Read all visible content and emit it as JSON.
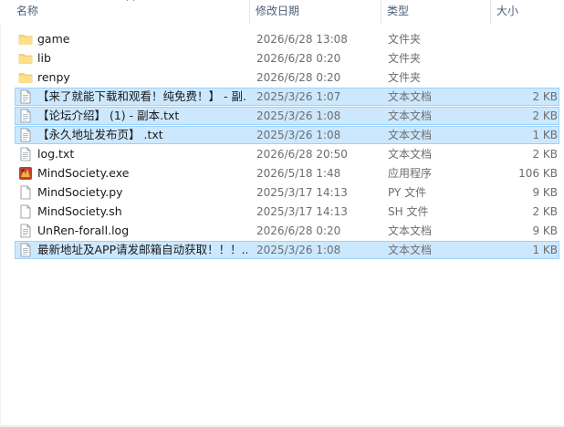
{
  "columns": {
    "name": "名称",
    "date": "修改日期",
    "type": "类型",
    "size": "大小"
  },
  "files": [
    {
      "name": "game",
      "date": "2026/6/28 13:08",
      "type": "文件夹",
      "size": "",
      "icon": "folder-icon",
      "selected": false
    },
    {
      "name": "lib",
      "date": "2026/6/28 0:20",
      "type": "文件夹",
      "size": "",
      "icon": "folder-icon",
      "selected": false
    },
    {
      "name": "renpy",
      "date": "2026/6/28 0:20",
      "type": "文件夹",
      "size": "",
      "icon": "folder-icon",
      "selected": false
    },
    {
      "name": "【来了就能下载和观看！纯免费！】 - 副...",
      "date": "2025/3/26 1:07",
      "type": "文本文档",
      "size": "2 KB",
      "icon": "text-file-icon",
      "selected": true
    },
    {
      "name": "【论坛介绍】 (1) - 副本.txt",
      "date": "2025/3/26 1:08",
      "type": "文本文档",
      "size": "2 KB",
      "icon": "text-file-icon",
      "selected": true
    },
    {
      "name": "【永久地址发布页】 .txt",
      "date": "2025/3/26 1:08",
      "type": "文本文档",
      "size": "1 KB",
      "icon": "text-file-icon",
      "selected": true
    },
    {
      "name": "log.txt",
      "date": "2026/6/28 20:50",
      "type": "文本文档",
      "size": "2 KB",
      "icon": "text-file-icon",
      "selected": false
    },
    {
      "name": "MindSociety.exe",
      "date": "2026/5/18 1:48",
      "type": "应用程序",
      "size": "106 KB",
      "icon": "app-icon",
      "selected": false
    },
    {
      "name": "MindSociety.py",
      "date": "2025/3/17 14:13",
      "type": "PY 文件",
      "size": "9 KB",
      "icon": "file-icon",
      "selected": false
    },
    {
      "name": "MindSociety.sh",
      "date": "2025/3/17 14:13",
      "type": "SH 文件",
      "size": "2 KB",
      "icon": "file-icon",
      "selected": false
    },
    {
      "name": "UnRen-forall.log",
      "date": "2026/6/28 0:20",
      "type": "文本文档",
      "size": "9 KB",
      "icon": "text-file-icon",
      "selected": false
    },
    {
      "name": "最新地址及APP请发邮箱自动获取！！！...",
      "date": "2025/3/26 1:08",
      "type": "文本文档",
      "size": "1 KB",
      "icon": "text-file-icon",
      "selected": true
    }
  ]
}
